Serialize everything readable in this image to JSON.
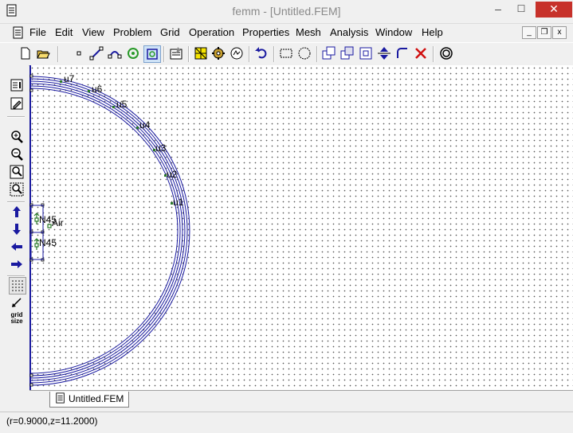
{
  "window": {
    "title": "femm - [Untitled.FEM]",
    "minimize": "–",
    "maximize": "☐",
    "close": "✕"
  },
  "menu": [
    "File",
    "Edit",
    "View",
    "Problem",
    "Grid",
    "Operation",
    "Properties",
    "Mesh",
    "Analysis",
    "Window",
    "Help"
  ],
  "mdi": {
    "minimize": "_",
    "restore": "❐",
    "close": "x"
  },
  "canvas_labels": {
    "u7": "u7",
    "u6": "u6",
    "u5": "u5",
    "u4": "u4",
    "u3": "u3",
    "u2": "u2",
    "u1": "u1",
    "n45_top": "N45",
    "air": "Air",
    "n45_bottom": "N45"
  },
  "vtool": {
    "grid_size": "grid size"
  },
  "tab": {
    "label": "Untitled.FEM"
  },
  "status": {
    "text": "(r=0.9000,z=11.2000)"
  },
  "colors": {
    "coil": "#1a1aa0",
    "accent": "#2a7a2a",
    "close": "#c7312a"
  }
}
